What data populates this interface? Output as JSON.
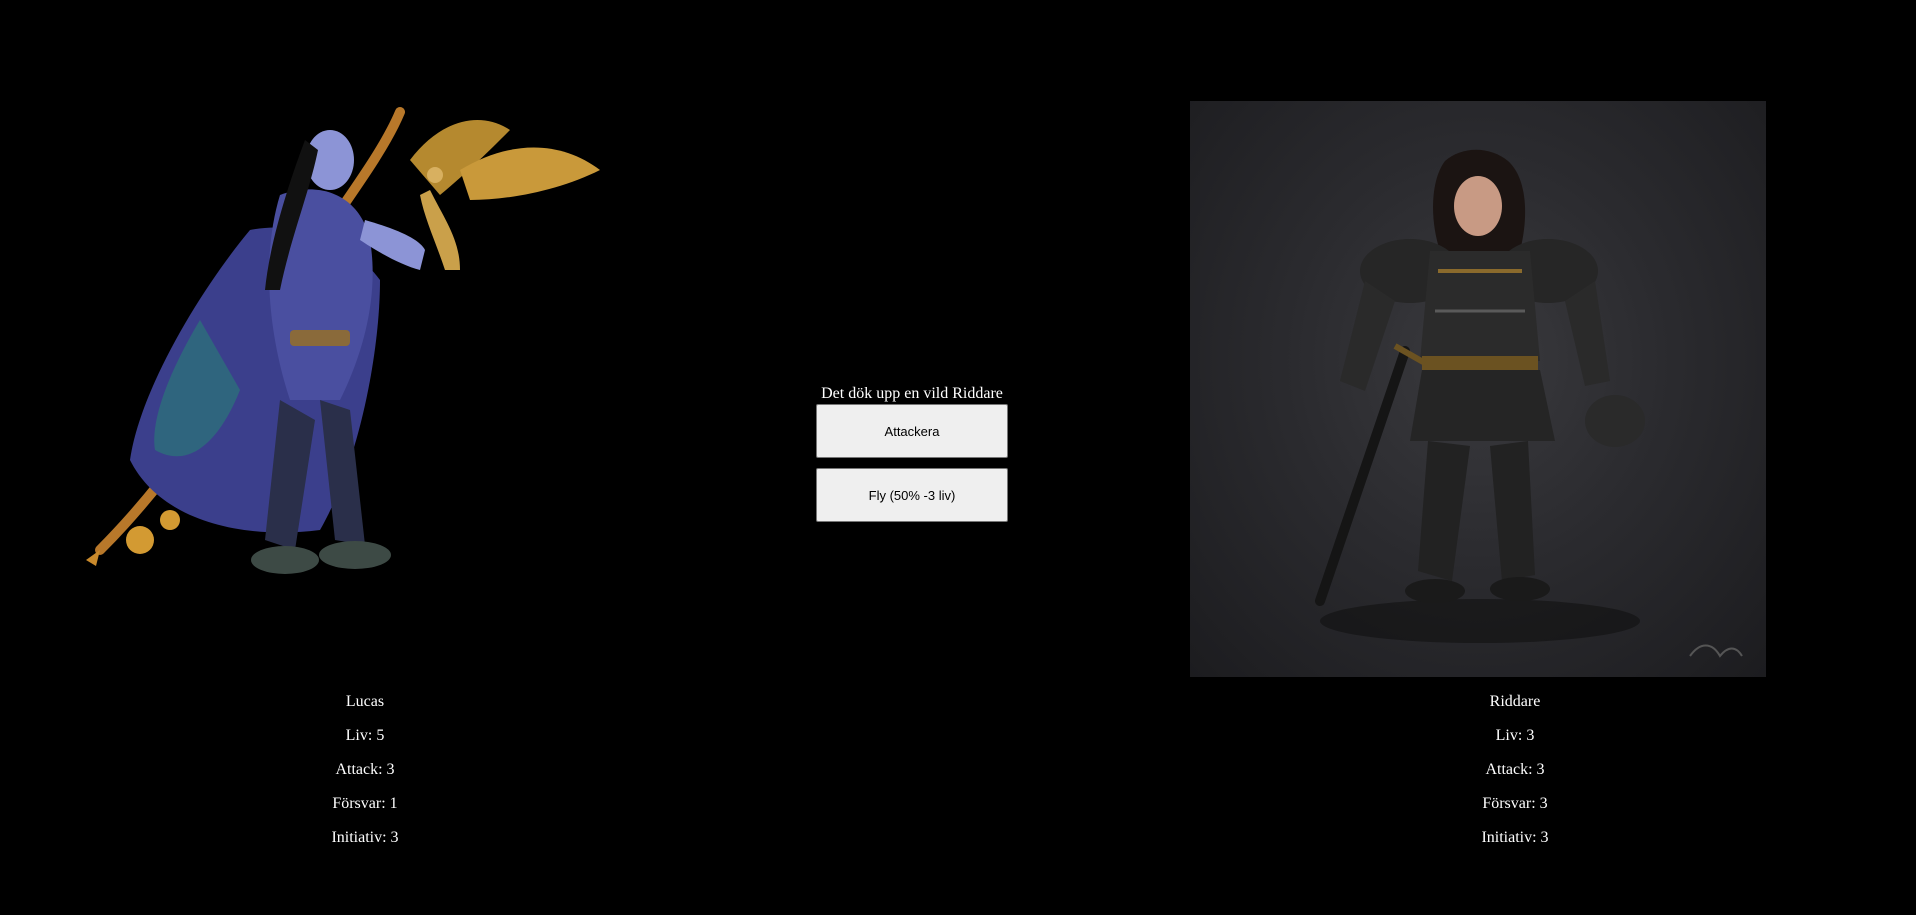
{
  "encounter": {
    "message": "Det dök upp en vild Riddare",
    "attack_label": "Attackera",
    "flee_label": "Fly (50% -3 liv)"
  },
  "player": {
    "name": "Lucas",
    "life": "Liv: 5",
    "attack": "Attack: 3",
    "defense": "Försvar: 1",
    "initiative": "Initiativ: 3",
    "portrait_icon": "elf-druid-with-hawk"
  },
  "enemy": {
    "name": "Riddare",
    "life": "Liv: 3",
    "attack": "Attack: 3",
    "defense": "Försvar: 3",
    "initiative": "Initiativ: 3",
    "portrait_icon": "armored-knight"
  },
  "colors": {
    "background": "#000000",
    "text": "#ffffff",
    "button_bg": "#efefef"
  }
}
